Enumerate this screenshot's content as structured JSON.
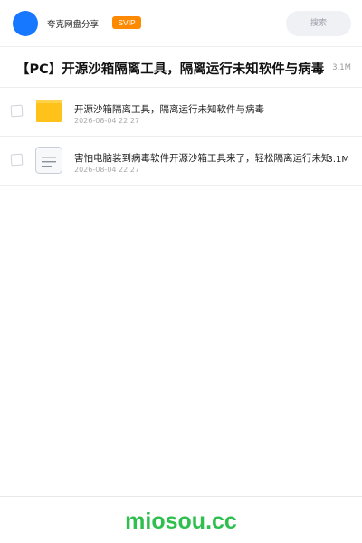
{
  "header": {
    "title": "夸克网盘分享",
    "badge": "SVIP",
    "search_label": "搜索",
    "avatar_color": "#1677ff"
  },
  "share": {
    "title": "【PC】开源沙箱隔离工具，隔离运行未知软件与病毒",
    "total_size": "3.1M"
  },
  "files": [
    {
      "name": "开源沙箱隔离工具，隔离运行未知软件与病毒",
      "date": "2026-08-04 22:27",
      "size": "",
      "icon": "folder-icon"
    },
    {
      "name": "害怕电脑装到病毒软件开源沙箱工具来了，轻松隔离运行未知软件",
      "date": "2026-08-04 22:27",
      "size": "3.1M",
      "icon": "document-icon"
    }
  ],
  "footer": {
    "brand": "miosou.cc",
    "brand_color": "#2fbf4f"
  }
}
